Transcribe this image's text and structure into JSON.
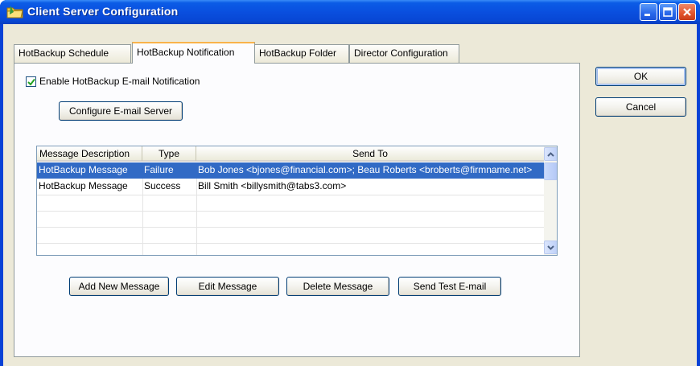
{
  "window": {
    "title": "Client Server Configuration"
  },
  "tabs": [
    {
      "label": "HotBackup Schedule",
      "active": false
    },
    {
      "label": "HotBackup Notification",
      "active": true
    },
    {
      "label": "HotBackup Folder",
      "active": false
    },
    {
      "label": "Director Configuration",
      "active": false
    }
  ],
  "notification": {
    "enable_label": "Enable HotBackup E-mail Notification",
    "enable_checked": true,
    "configure_button": "Configure E-mail Server"
  },
  "message_list": {
    "columns": [
      "Message Description",
      "Type",
      "Send To"
    ],
    "rows": [
      {
        "description": "HotBackup Message",
        "type": "Failure",
        "send_to": "Bob Jones <bjones@financial.com>; Beau Roberts <broberts@firmname.net>",
        "selected": true
      },
      {
        "description": "HotBackup Message",
        "type": "Success",
        "send_to": "Bill Smith <billysmith@tabs3.com>",
        "selected": false
      }
    ]
  },
  "actions": {
    "add": "Add New Message",
    "edit": "Edit Message",
    "delete": "Delete Message",
    "test": "Send Test E-mail"
  },
  "dialog": {
    "ok": "OK",
    "cancel": "Cancel"
  },
  "colors": {
    "titlebar": "#0a4fdf",
    "selection": "#316ac5",
    "active_tab_accent": "#f9b34a",
    "dialog_background": "#ece9d8"
  }
}
